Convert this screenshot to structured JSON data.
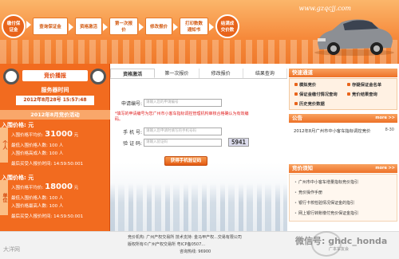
{
  "header": {
    "site_url": "www.gzqcjj.com",
    "steps": [
      "缴付保证金",
      "查询保证金",
      "资格激活",
      "第一次报价",
      "修改报价",
      "打印数数通知书",
      "结满成交价数"
    ]
  },
  "left": {
    "ribbon": "竞价播报",
    "server_title": "服务器时间",
    "server_time": "2012年8月28号 15:57:48",
    "month_title": "2012年8月竞价活动",
    "personal": {
      "tag": "个人",
      "header": "入围价格: 元",
      "avg_label": "入围价格平均价:",
      "avg_value": "31000",
      "avg_unit": "元",
      "lowest_label": "最低入围价格人数: 100 人",
      "highest_label": "入围价格高成人数: 100 人",
      "last_time": "最后买受人报价时间: 14:59:50:001"
    },
    "company": {
      "tag": "单位",
      "header": "入围价格: 元",
      "avg_label": "入围价格平均价:",
      "avg_value": "18000",
      "avg_unit": "元",
      "lowest_label": "最低入围价格人数: 100 人",
      "highest_label": "入围价格最高人数: 100 人",
      "last_time": "最后买受人报价时间: 14:59:50:001"
    }
  },
  "tabs": [
    "资格激活",
    "第一次报价",
    "修改报价",
    "结果查询"
  ],
  "form": {
    "apply_label": "申请编号:",
    "apply_placeholder": "请输入您的申请编号",
    "notice": "*填写的申请编号为您广州市小客车指标调控管理机构审核合格确认为有效编码。",
    "phone_label": "手 机 号:",
    "phone_placeholder": "请输入您申请时填写的手机号码",
    "captcha_label": "验 证 码:",
    "captcha_placeholder": "请输入验证码",
    "captcha_value": "5941",
    "get_code": "获得手机验证码"
  },
  "right": {
    "quick_title": "快速通道",
    "quick_links": [
      "模拟竞价",
      "存疑保证金名单",
      "保证金缴付情况查询",
      "竞价结果查询",
      "历史竞价数据"
    ],
    "announce_title": "公告",
    "more": "more >>",
    "announcements": [
      {
        "text": "2012年8月广州市中小客车指标调控竞价",
        "date": "8-30"
      }
    ],
    "notes_title": "竞价须知",
    "notes": [
      "广州市中小客车增量指标竞价指引",
      "竞价操作手册",
      "银行卡校检验情况保证金的指引",
      "网上银行转账缴付竞价保证金指引"
    ]
  },
  "footer": {
    "line1": "竞价机构: 广州产权交易所  技术支持: 金马甲产权...交易有限公司",
    "line2": "版权所有©广州产权交易所  粤ICP备0507...",
    "line3": "咨询热线: 96900",
    "watermark_left": "大洋网",
    "watermark_right": "微信号: ghdc_honda",
    "watermark_right2": "广本车友会"
  },
  "colors": {
    "brand_orange": "#f26b1f",
    "accent_red": "#e02020"
  }
}
